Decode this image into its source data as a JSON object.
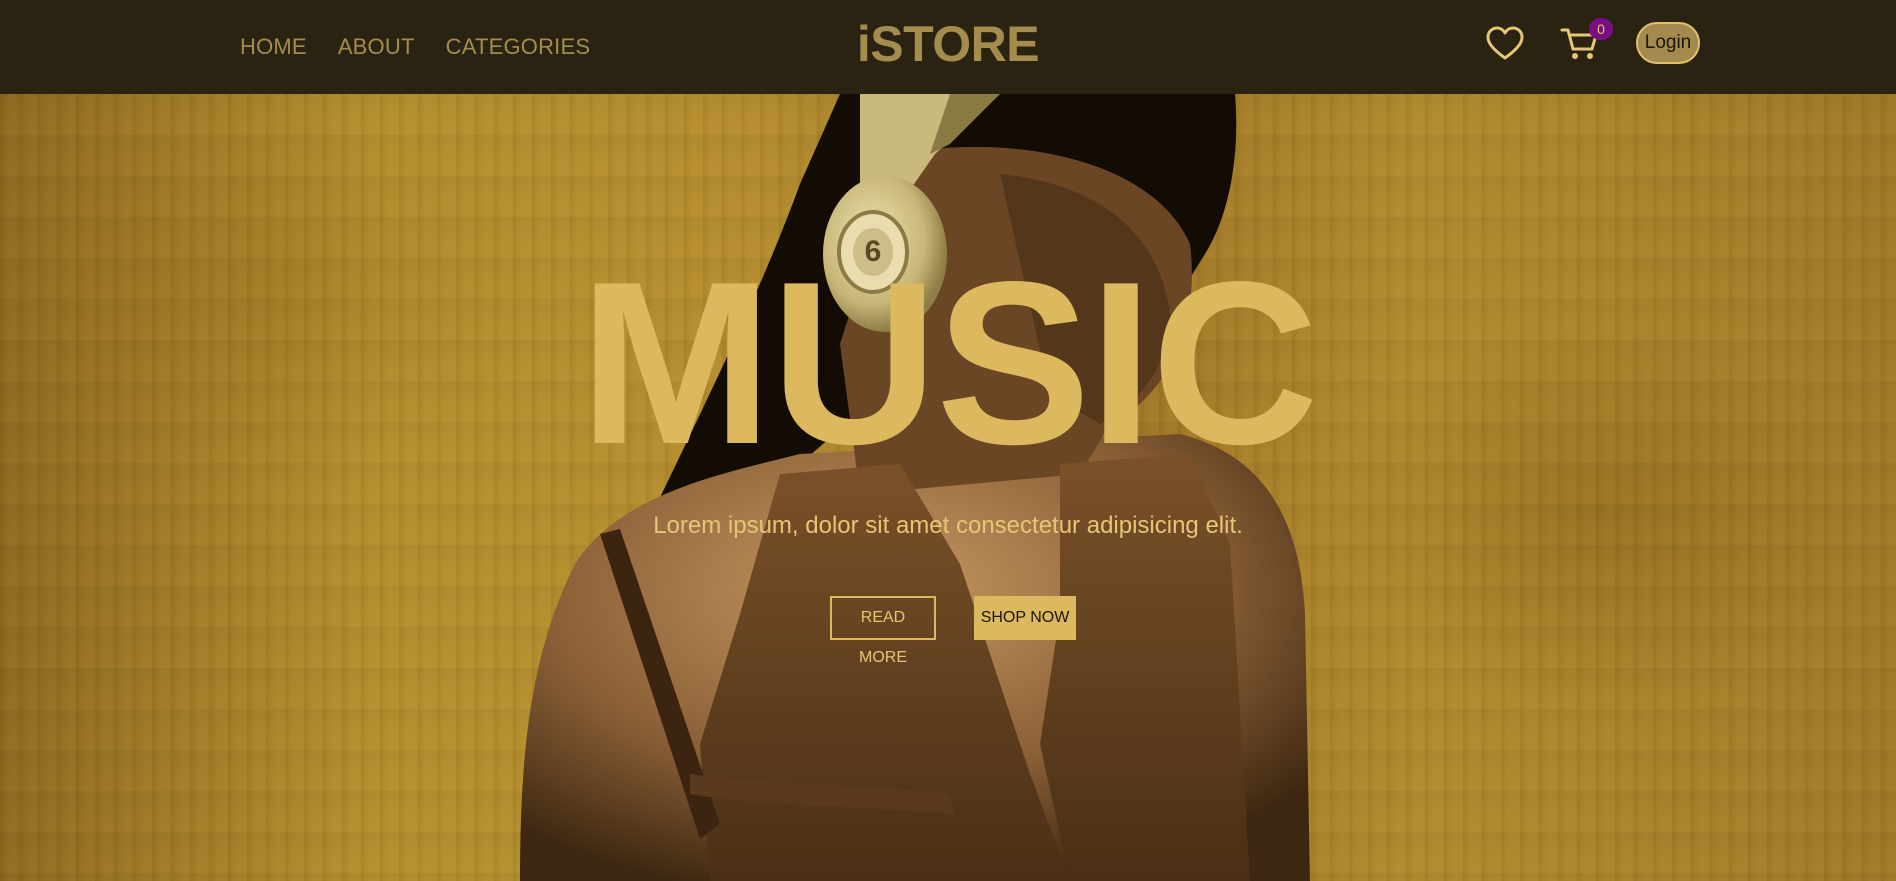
{
  "navbar": {
    "links": [
      "HOME",
      "ABOUT",
      "CATEGORIES"
    ],
    "brand": "iSTORE",
    "wishlist_icon": "heart-icon",
    "cart_icon": "cart-icon",
    "cart_count": "0",
    "login_label": "Login"
  },
  "hero": {
    "title": "MUSIC",
    "subtitle": "Lorem ipsum, dolor sit amet consectetur adipisicing elit.",
    "read_more_label": "READ MORE",
    "shop_now_label": "SHOP NOW",
    "headphone_badge": "6"
  },
  "colors": {
    "navbar_bg": "#2a2312",
    "nav_text": "#a48d4c",
    "accent_gold": "#dcb85e",
    "badge_purple": "#7a0f82",
    "hero_bg": "#b8902f"
  }
}
